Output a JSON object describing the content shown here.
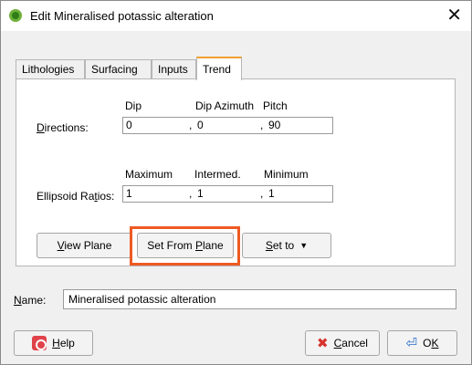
{
  "window": {
    "title": "Edit Mineralised potassic alteration",
    "close_label": "✕"
  },
  "tabs": [
    {
      "label": "Lithologies",
      "active": false
    },
    {
      "label": "Surfacing",
      "active": false
    },
    {
      "label": "Inputs",
      "active": false
    },
    {
      "label": "Trend",
      "active": true
    }
  ],
  "trend": {
    "directions": {
      "label": "Directions:",
      "col_dip": "Dip",
      "col_dip_azimuth": "Dip Azimuth",
      "col_pitch": "Pitch",
      "dip": "0",
      "dip_azimuth": "0",
      "pitch": "90"
    },
    "ellipsoid": {
      "label": "Ellipsoid Ratios:",
      "col_maximum": "Maximum",
      "col_intermed": "Intermed.",
      "col_minimum": "Minimum",
      "maximum": "1",
      "intermed": "1",
      "minimum": "1"
    },
    "separator": ",",
    "buttons": {
      "view_plane": "View Plane",
      "set_from_plane": "Set From Plane",
      "set_to": "Set to",
      "dropdown_arrow": "▼"
    }
  },
  "name": {
    "label": "Name:",
    "value": "Mineralised potassic alteration"
  },
  "footer": {
    "help": "Help",
    "cancel": "Cancel",
    "ok": "OK"
  },
  "colors": {
    "highlight": "#ee5a24",
    "active_tab_accent": "#f0a030"
  }
}
